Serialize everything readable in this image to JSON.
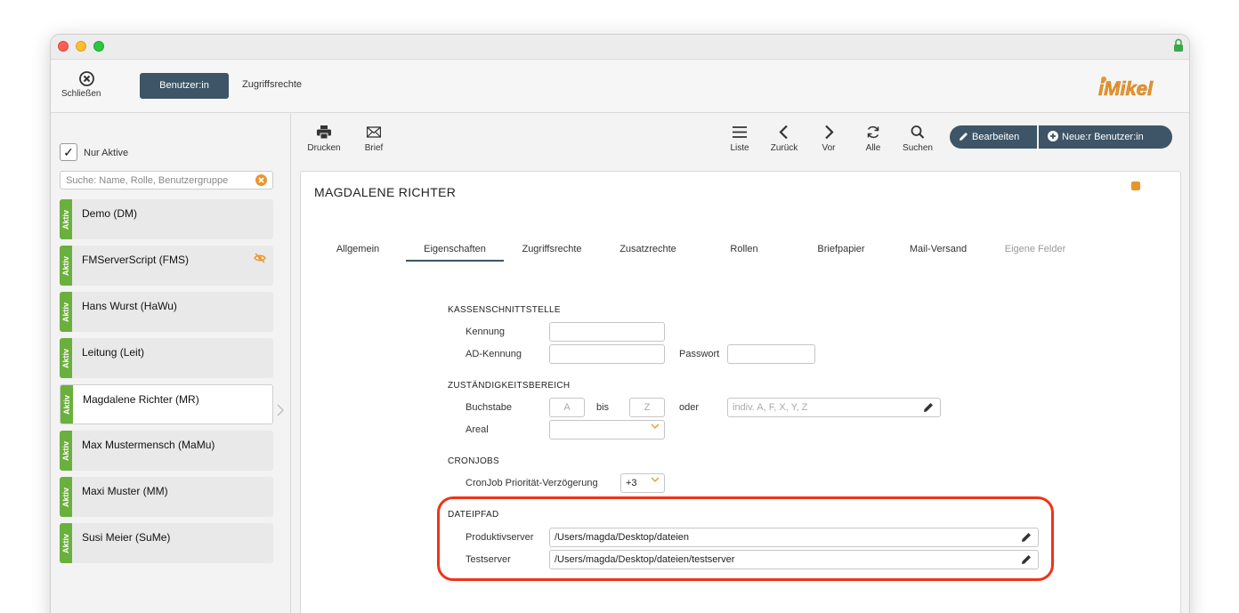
{
  "window": {
    "close_label": "Schließen",
    "tabs": [
      "Benutzer:in",
      "Zugriffsrechte"
    ],
    "logo_text": "iMikel"
  },
  "sidebar": {
    "filter_label": "Nur Aktive",
    "filter_checked": true,
    "search_placeholder": "Suche: Name, Rolle, Benutzergruppe",
    "status_label": "Aktiv",
    "users": [
      {
        "name": "Demo (DM)",
        "hidden": false,
        "selected": false
      },
      {
        "name": "FMServerScript (FMS)",
        "hidden": true,
        "selected": false
      },
      {
        "name": "Hans Wurst (HaWu)",
        "hidden": false,
        "selected": false
      },
      {
        "name": "Leitung (Leit)",
        "hidden": false,
        "selected": false
      },
      {
        "name": "Magdalene Richter (MR)",
        "hidden": false,
        "selected": true
      },
      {
        "name": "Max Mustermensch (MaMu)",
        "hidden": false,
        "selected": false
      },
      {
        "name": "Maxi Muster (MM)",
        "hidden": false,
        "selected": false
      },
      {
        "name": "Susi Meier (SuMe)",
        "hidden": false,
        "selected": false
      }
    ]
  },
  "toolbar": {
    "print": "Drucken",
    "letter": "Brief",
    "list": "Liste",
    "back": "Zurück",
    "forward": "Vor",
    "all": "Alle",
    "search": "Suchen",
    "edit": "Bearbeiten",
    "new_user": "Neue:r Benutzer:in"
  },
  "record": {
    "title": "MAGDALENE RICHTER",
    "tabs": [
      "Allgemein",
      "Eigenschaften",
      "Zugriffsrechte",
      "Zusatzrechte",
      "Rollen",
      "Briefpapier",
      "Mail-Versand",
      "Eigene Felder"
    ],
    "active_tab": "Eigenschaften",
    "kasse": {
      "heading": "KASSENSCHNITTSTELLE",
      "kennung_label": "Kennung",
      "kennung_value": "",
      "ad_label": "AD-Kennung",
      "ad_value": "",
      "passwort_label": "Passwort",
      "passwort_value": ""
    },
    "zust": {
      "heading": "ZUSTÄNDIGKEITSBEREICH",
      "buchstabe_label": "Buchstabe",
      "from_placeholder": "A",
      "bis_label": "bis",
      "to_placeholder": "Z",
      "oder_label": "oder",
      "indiv_placeholder": "indiv. A, F, X, Y, Z",
      "areal_label": "Areal",
      "areal_value": ""
    },
    "cron": {
      "heading": "CRONJOBS",
      "delay_label": "CronJob Priorität-Verzögerung",
      "delay_value": "+3"
    },
    "pfad": {
      "heading": "DATEIPFAD",
      "prod_label": "Produktivserver",
      "prod_value": "/Users/magda/Desktop/dateien",
      "test_label": "Testserver",
      "test_value": "/Users/magda/Desktop/dateien/testserver"
    }
  },
  "colors": {
    "accent_dark": "#3d5566",
    "active_badge": "#6ab03c",
    "orange": "#e8962c",
    "highlight": "#f03318"
  }
}
